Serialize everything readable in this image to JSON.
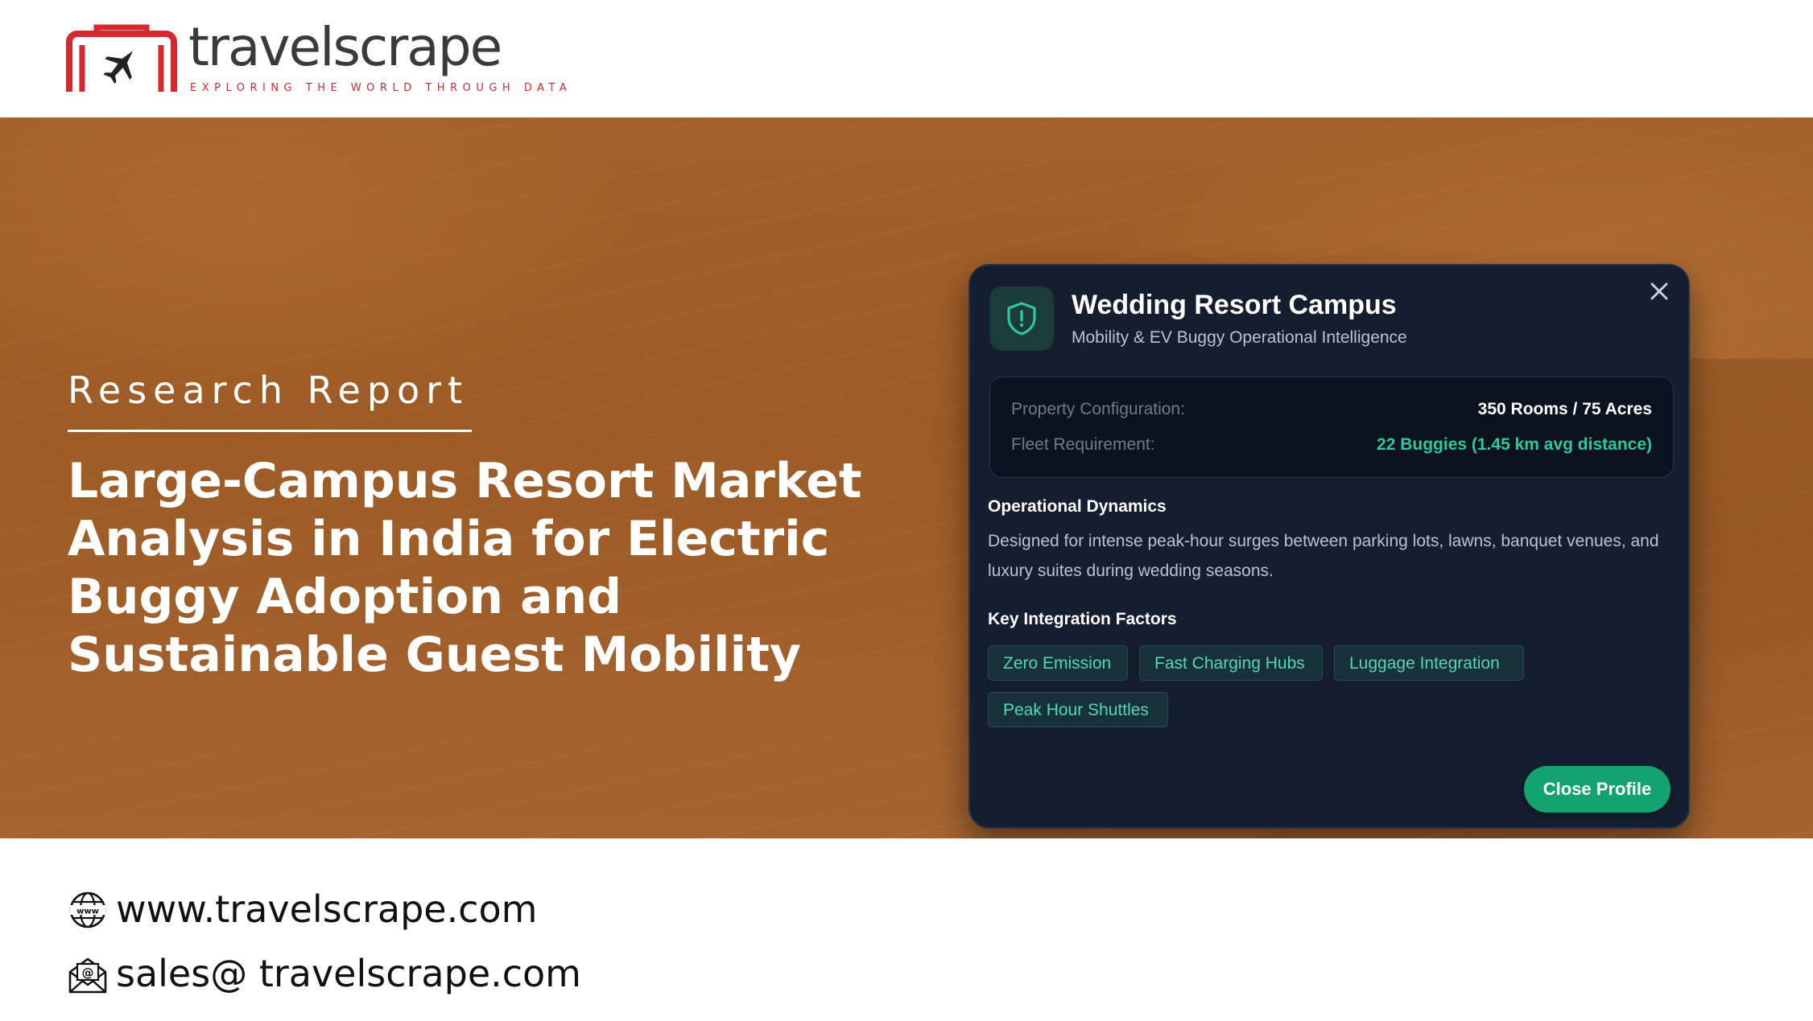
{
  "header": {
    "logo_word": "travelscrape",
    "logo_tagline": "EXPLORING THE WORLD THROUGH DATA",
    "logo_icon": "suitcase-plane-icon"
  },
  "hero": {
    "label": "Research Report",
    "title": "Large-Campus Resort Market Analysis in India for Electric Buggy Adoption and Sustainable Guest Mobility"
  },
  "modal": {
    "title": "Wedding Resort Campus",
    "subtitle": "Mobility & EV Buggy Operational Intelligence",
    "icon": "shield-alert-icon",
    "close_icon": "close-icon",
    "config": {
      "property_label": "Property Configuration:",
      "property_value": "350 Rooms / 75 Acres",
      "fleet_label": "Fleet Requirement:",
      "fleet_value": "22 Buggies (1.45 km avg distance)"
    },
    "dynamics_heading": "Operational Dynamics",
    "dynamics_text": "Designed for intense peak-hour surges between parking lots, lawns, banquet venues, and luxury suites during wedding seasons.",
    "factors_heading": "Key Integration Factors",
    "factors": [
      "Zero Emission",
      "Fast Charging Hubs",
      "Luggage Integration",
      "Peak Hour Shuttles"
    ],
    "close_button": "Close Profile"
  },
  "contacts": {
    "website": "www.travelscrape.com",
    "email": "sales@ travelscrape.com",
    "website_icon": "globe-www-icon",
    "email_icon": "email-envelope-icon"
  },
  "colors": {
    "brand_red": "#d7282f",
    "hero_bg": "#a5612a",
    "modal_bg": "#151e2f",
    "accent_green": "#12a371",
    "tag_text": "#54d6b0"
  }
}
